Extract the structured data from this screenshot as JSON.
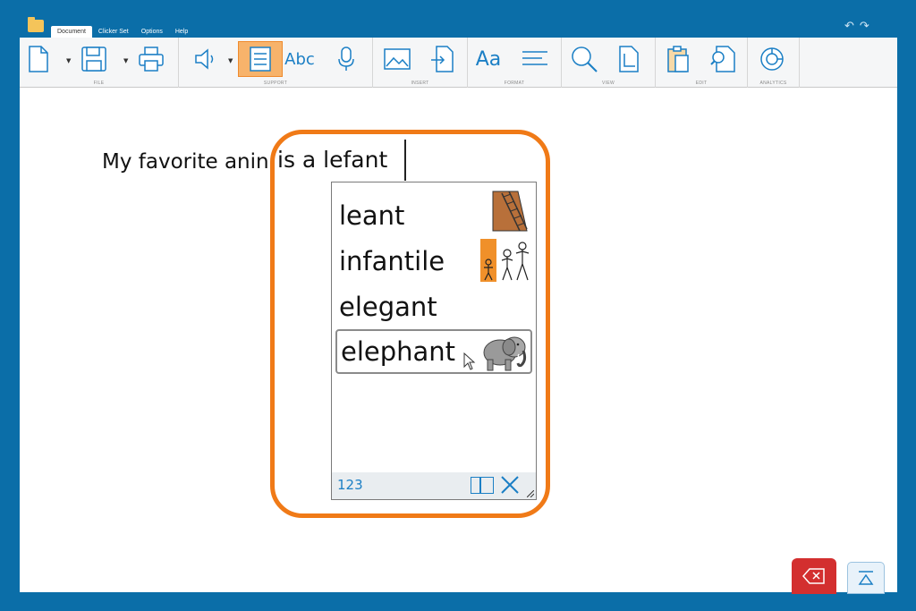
{
  "app": {
    "folder_icon": "folder-icon"
  },
  "menu": {
    "tabs": [
      "Document",
      "Clicker Set",
      "Options",
      "Help"
    ],
    "active": "Document"
  },
  "titlebar": {
    "undo_icon": "undo-icon",
    "redo_icon": "redo-icon"
  },
  "ribbon": {
    "groups": [
      {
        "label": "FILE",
        "tools": [
          "new-document-icon",
          "save-icon",
          "print-icon"
        ]
      },
      {
        "label": "SUPPORT",
        "tools": [
          "speech-icon",
          "predictor-icon",
          "spellcheck-icon",
          "microphone-icon"
        ],
        "active_tool": "predictor-icon"
      },
      {
        "label": "INSERT",
        "tools": [
          "insert-picture-icon",
          "insert-file-icon"
        ]
      },
      {
        "label": "FORMAT",
        "tools": [
          "font-icon",
          "paragraph-icon"
        ]
      },
      {
        "label": "VIEW",
        "tools": [
          "zoom-icon",
          "page-size-icon"
        ]
      },
      {
        "label": "EDIT",
        "tools": [
          "paste-icon",
          "find-icon"
        ]
      },
      {
        "label": "ANALYTICS",
        "tools": [
          "analytics-icon"
        ]
      }
    ],
    "spell_label": "Abc",
    "font_label": "Aa"
  },
  "document": {
    "text_part1": "My favorite anin",
    "text_part2": "is a lefant"
  },
  "predictor": {
    "items": [
      {
        "word": "leant",
        "symbol": "ladder-symbol"
      },
      {
        "word": "infantile",
        "symbol": "children-symbol"
      },
      {
        "word": "elegant",
        "symbol": ""
      },
      {
        "word": "elephant",
        "symbol": "elephant-symbol",
        "selected": true
      }
    ],
    "footer": {
      "numbers_label": "123"
    }
  },
  "bottom_buttons": {
    "backspace_icon": "backspace-icon",
    "collapse_icon": "collapse-icon"
  },
  "colors": {
    "accent": "#f07a17",
    "brand_blue": "#0b6ea8",
    "backspace_red": "#d32f2f"
  }
}
